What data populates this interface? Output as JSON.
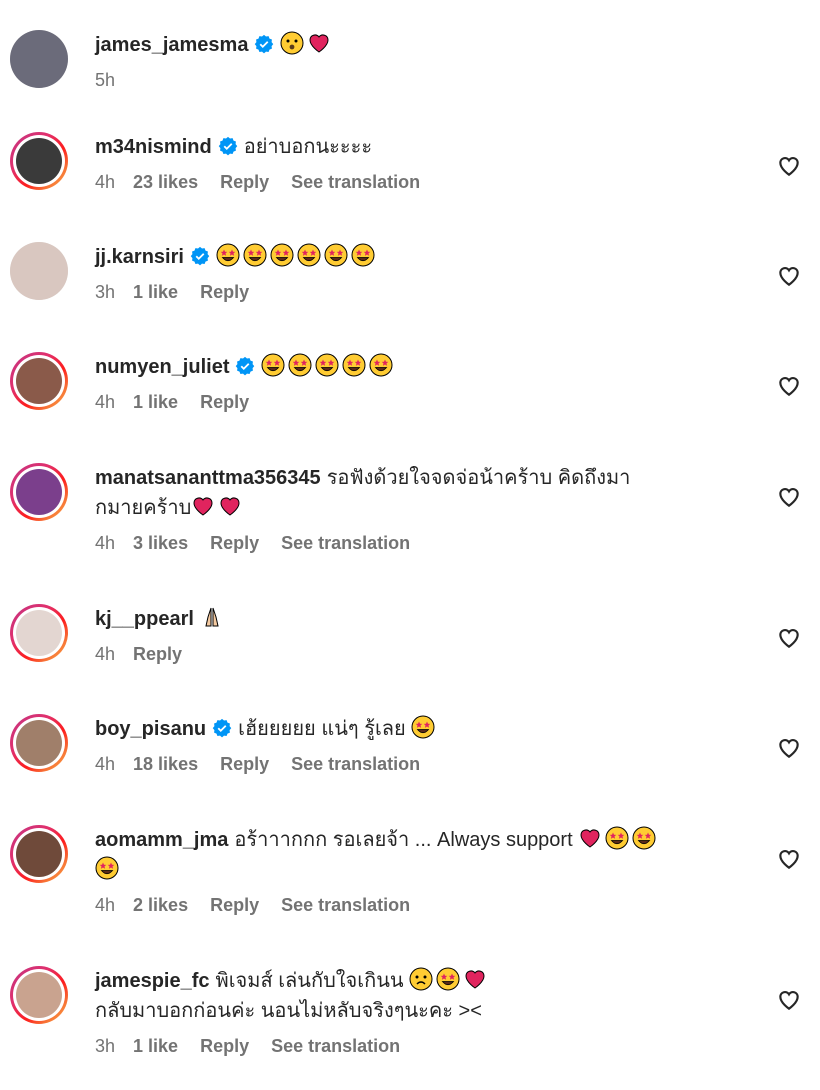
{
  "comments": [
    {
      "user": "james_jamesma",
      "verified": true,
      "text": "",
      "emojis": [
        "surprised",
        "heart"
      ],
      "text2": "",
      "emojis2": [],
      "time": "5h",
      "likes": "",
      "reply": "",
      "translate": "",
      "has_like": false,
      "story": false
    },
    {
      "user": "m34nismind",
      "verified": true,
      "text": "อย่าบอกนะะะะ",
      "emojis": [],
      "text2": "",
      "emojis2": [],
      "time": "4h",
      "likes": "23 likes",
      "reply": "Reply",
      "translate": "See translation",
      "has_like": true,
      "story": true
    },
    {
      "user": "jj.karnsiri",
      "verified": true,
      "text": "",
      "emojis": [
        "starstruck",
        "starstruck",
        "starstruck",
        "starstruck",
        "starstruck",
        "starstruck"
      ],
      "text2": "",
      "emojis2": [],
      "time": "3h",
      "likes": "1 like",
      "reply": "Reply",
      "translate": "",
      "has_like": true,
      "story": false
    },
    {
      "user": "numyen_juliet",
      "verified": true,
      "text": "",
      "emojis": [
        "starstruck",
        "starstruck",
        "starstruck",
        "starstruck",
        "starstruck"
      ],
      "text2": "",
      "emojis2": [],
      "time": "4h",
      "likes": "1 like",
      "reply": "Reply",
      "translate": "",
      "has_like": true,
      "story": true
    },
    {
      "user": "manatsananttma356345",
      "verified": false,
      "text": "รอฟังด้วยใจจดจ่อน้าคร้าบ คิดถึงมา",
      "emojis": [],
      "text2": "กมายคร้าบ",
      "emojis2": [
        "heart",
        "heart"
      ],
      "time": "4h",
      "likes": "3 likes",
      "reply": "Reply",
      "translate": "See translation",
      "has_like": true,
      "story": true
    },
    {
      "user": "kj__ppearl",
      "verified": false,
      "text": "",
      "emojis": [
        "pray"
      ],
      "text2": "",
      "emojis2": [],
      "time": "4h",
      "likes": "",
      "reply": "Reply",
      "translate": "",
      "has_like": true,
      "story": true
    },
    {
      "user": "boy_pisanu",
      "verified": true,
      "text": "เฮ้ยยยยย แน่ๆ รู้เลย",
      "emojis": [
        "starstruck"
      ],
      "text2": "",
      "emojis2": [],
      "time": "4h",
      "likes": "18 likes",
      "reply": "Reply",
      "translate": "See translation",
      "has_like": true,
      "story": true
    },
    {
      "user": "aomamm_jma",
      "verified": false,
      "text": "อร้าาากกก รอเลยจ้า ... Always support",
      "emojis": [
        "heart",
        "starstruck",
        "starstruck"
      ],
      "text2": "",
      "emojis2": [
        "starstruck"
      ],
      "time": "4h",
      "likes": "2 likes",
      "reply": "Reply",
      "translate": "See translation",
      "has_like": true,
      "story": true
    },
    {
      "user": "jamespie_fc",
      "verified": false,
      "text": "พิเจมส์ เล่นกับใจเกินน",
      "emojis": [
        "frown",
        "starstruck",
        "heart"
      ],
      "text2": "กลับมาบอกก่อนค่ะ นอนไม่หลับจริงๆนะคะ ><",
      "emojis2": [],
      "time": "3h",
      "likes": "1 like",
      "reply": "Reply",
      "translate": "See translation",
      "has_like": true,
      "story": true
    }
  ],
  "colors": {
    "verified": "#0095f6",
    "heart": "#e0245e",
    "emoji": "#ffcc33",
    "meta": "#737373"
  }
}
